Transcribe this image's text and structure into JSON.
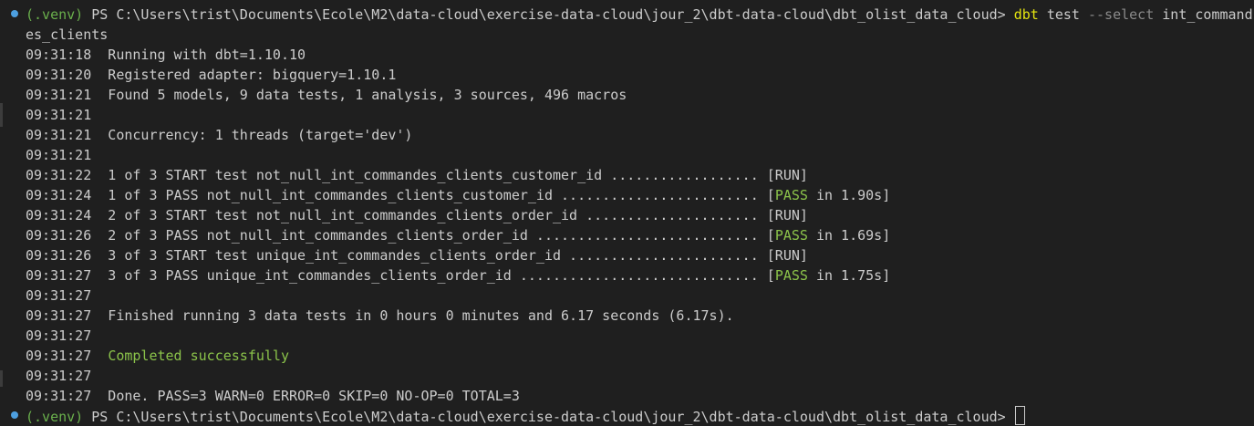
{
  "prompt1": {
    "venv": "(.venv)",
    "ps": " PS ",
    "path": "C:\\Users\\trist\\Documents\\Ecole\\M2\\data-cloud\\exercise-data-cloud\\jour_2\\dbt-data-cloud\\dbt_olist_data_cloud>",
    "cmd": "dbt",
    "arg1": " test",
    "flag": " --select",
    "arg2": " int_command",
    "wrap": "es_clients"
  },
  "log": [
    {
      "t": "09:31:18",
      "msg": "  Running with dbt=1.10.10"
    },
    {
      "t": "09:31:20",
      "msg": "  Registered adapter: bigquery=1.10.1"
    },
    {
      "t": "09:31:21",
      "msg": "  Found 5 models, 9 data tests, 1 analysis, 3 sources, 496 macros"
    },
    {
      "t": "09:31:21",
      "msg": ""
    },
    {
      "t": "09:31:21",
      "msg": "  Concurrency: 1 threads (target='dev')"
    },
    {
      "t": "09:31:21",
      "msg": ""
    },
    {
      "t": "09:31:22",
      "msg": "  1 of 3 START test not_null_int_commandes_clients_customer_id .................. [RUN]"
    },
    {
      "t": "09:31:24",
      "msg": "  1 of 3 PASS not_null_int_commandes_clients_customer_id ........................ [",
      "pass": "PASS",
      "tail": " in 1.90s]"
    },
    {
      "t": "09:31:24",
      "msg": "  2 of 3 START test not_null_int_commandes_clients_order_id ..................... [RUN]"
    },
    {
      "t": "09:31:26",
      "msg": "  2 of 3 PASS not_null_int_commandes_clients_order_id ........................... [",
      "pass": "PASS",
      "tail": " in 1.69s]"
    },
    {
      "t": "09:31:26",
      "msg": "  3 of 3 START test unique_int_commandes_clients_order_id ....................... [RUN]"
    },
    {
      "t": "09:31:27",
      "msg": "  3 of 3 PASS unique_int_commandes_clients_order_id ............................. [",
      "pass": "PASS",
      "tail": " in 1.75s]"
    },
    {
      "t": "09:31:27",
      "msg": ""
    },
    {
      "t": "09:31:27",
      "msg": "  Finished running 3 data tests in 0 hours 0 minutes and 6.17 seconds (6.17s)."
    },
    {
      "t": "09:31:27",
      "msg": ""
    },
    {
      "t": "09:31:27",
      "msg": "  ",
      "success": "Completed successfully"
    },
    {
      "t": "09:31:27",
      "msg": ""
    },
    {
      "t": "09:31:27",
      "msg": "  Done. PASS=3 WARN=0 ERROR=0 SKIP=0 NO-OP=0 TOTAL=3"
    }
  ],
  "prompt2": {
    "venv": "(.venv)",
    "ps": " PS ",
    "path": "C:\\Users\\trist\\Documents\\Ecole\\M2\\data-cloud\\exercise-data-cloud\\jour_2\\dbt-data-cloud\\dbt_olist_data_cloud>",
    "input": " "
  },
  "colors": {
    "background": "#1f1f1f",
    "text": "#cccccc",
    "venv_green": "#6ab04c",
    "command_yellow": "#e5e510",
    "pass_green": "#8bc34a",
    "decoration_blue": "#4d9fe0"
  }
}
